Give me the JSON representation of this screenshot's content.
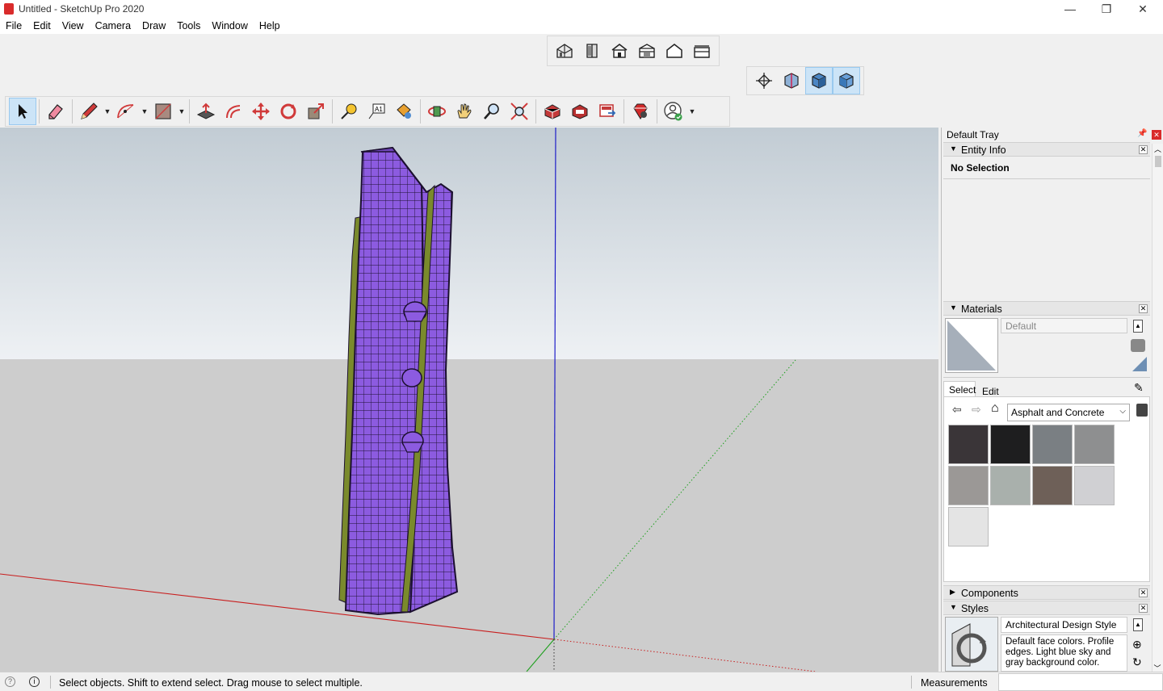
{
  "window": {
    "title": "Untitled - SketchUp Pro 2020",
    "minimize": "—",
    "restore": "❐",
    "close": "✕"
  },
  "menu": [
    "File",
    "Edit",
    "View",
    "Camera",
    "Draw",
    "Tools",
    "Window",
    "Help"
  ],
  "toolbars": {
    "views": [
      "iso-view-icon",
      "top-view-icon",
      "front-view-icon",
      "right-view-icon",
      "back-view-icon",
      "left-view-icon"
    ],
    "styles": [
      "xray-style-icon",
      "hidden-line-style-icon",
      "shaded-style-icon",
      "shaded-textures-style-icon"
    ],
    "main": [
      "select-icon",
      "eraser-icon",
      "pencil-icon",
      "arc-icon",
      "rectangle-icon",
      "push-pull-icon",
      "offset-icon",
      "move-icon",
      "rotate-icon",
      "scale-icon",
      "tape-measure-icon",
      "text-icon",
      "paint-bucket-icon",
      "orbit-icon",
      "pan-icon",
      "zoom-icon",
      "zoom-extents-icon",
      "3d-warehouse-icon",
      "extension-warehouse-icon",
      "layout-icon",
      "extension-manager-icon",
      "account-icon"
    ]
  },
  "tray": {
    "title": "Default Tray",
    "entity_info": {
      "header": "Entity Info",
      "selection": "No Selection"
    },
    "materials": {
      "header": "Materials",
      "name_placeholder": "Default",
      "tabs": [
        "Select",
        "Edit"
      ],
      "library": "Asphalt and Concrete",
      "swatches": [
        "#3a3538",
        "#1e1e1f",
        "#7a7f83",
        "#8e8f90",
        "#9b9896",
        "#a9b0ac",
        "#6e6058",
        "#d0d0d3",
        "#e4e4e4"
      ]
    },
    "components": {
      "header": "Components"
    },
    "styles": {
      "header": "Styles",
      "style_name": "Architectural Design Style",
      "description": "Default face colors. Profile edges. Light blue sky and gray background color."
    }
  },
  "status": {
    "message": "Select objects. Shift to extend select. Drag mouse to select multiple.",
    "measurements_label": "Measurements",
    "measurements_value": ""
  },
  "colors": {
    "sky_top": "#c2ccd4",
    "sky_bottom": "#eef1f4",
    "ground": "#cdcdcd",
    "model_face": "#8c5be0",
    "model_edge": "#1c1030",
    "accent_trim": "#7a8a2c",
    "axis_red": "#c81e1e",
    "axis_green": "#1ea01e",
    "axis_blue": "#1e1ec8"
  }
}
